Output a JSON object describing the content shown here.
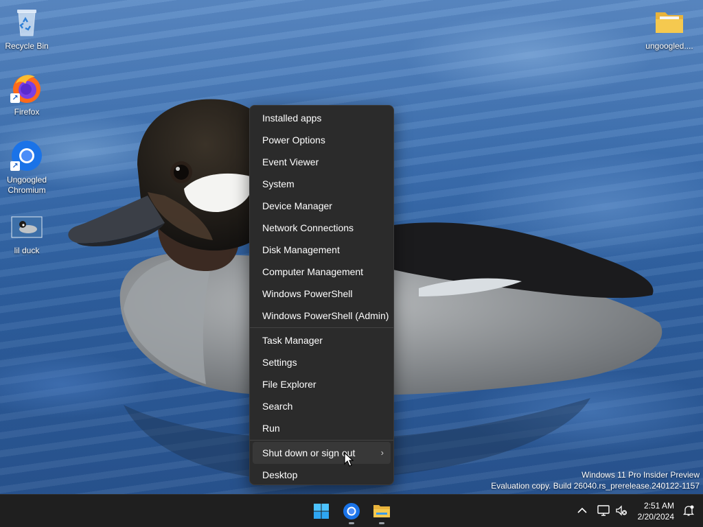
{
  "desktop": {
    "icons": [
      {
        "label": "Recycle Bin",
        "icon": "recycle-bin-icon"
      },
      {
        "label": "Firefox",
        "icon": "firefox-icon"
      },
      {
        "label": "Ungoogled\nChromium",
        "icon": "chromium-icon"
      },
      {
        "label": "lil duck",
        "icon": "image-thumbnail-icon"
      },
      {
        "label": "ungoogled....",
        "icon": "folder-icon"
      }
    ]
  },
  "menu": {
    "items_group1": [
      "Installed apps",
      "Power Options",
      "Event Viewer",
      "System",
      "Device Manager",
      "Network Connections",
      "Disk Management",
      "Computer Management",
      "Windows PowerShell",
      "Windows PowerShell (Admin)"
    ],
    "items_group2": [
      "Task Manager",
      "Settings",
      "File Explorer",
      "Search",
      "Run"
    ],
    "shutdown": "Shut down or sign out",
    "desktop": "Desktop",
    "chevron": "›"
  },
  "watermark": {
    "line1": "Windows 11 Pro Insider Preview",
    "line2": "Evaluation copy. Build 26040.rs_prerelease.240122-1157"
  },
  "taskbar": {
    "pinned": [
      {
        "name": "start-button",
        "icon": "windows-logo-icon",
        "running": false
      },
      {
        "name": "chromium-taskbar-button",
        "icon": "chromium-icon",
        "running": true
      },
      {
        "name": "file-explorer-taskbar-button",
        "icon": "folder-icon",
        "running": true
      }
    ],
    "tray": {
      "overflow_chevron": "^",
      "time": "2:51 AM",
      "date": "2/20/2024"
    }
  },
  "colors": {
    "menu_bg": "#2b2b2b",
    "taskbar_bg": "#1f1f1f",
    "accent": "#0078d4"
  }
}
